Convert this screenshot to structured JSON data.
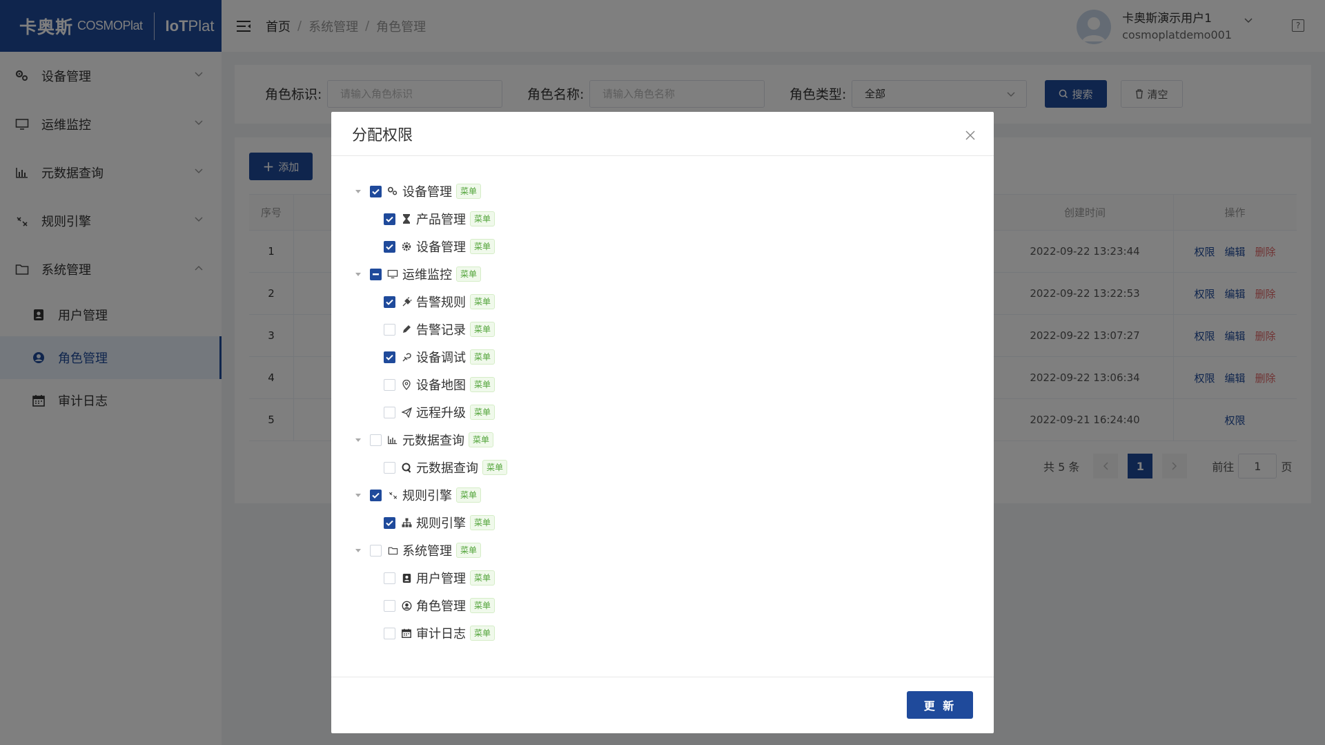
{
  "brand": {
    "cn": "卡奥斯",
    "cosmo": "COSMOPlat",
    "iot_prefix": "IoT",
    "iot_suffix": "Plat"
  },
  "sidebar": {
    "items": [
      {
        "label": "设备管理",
        "icon": "gears-icon"
      },
      {
        "label": "运维监控",
        "icon": "monitor-icon"
      },
      {
        "label": "元数据查询",
        "icon": "bar-chart-icon"
      },
      {
        "label": "规则引擎",
        "icon": "link-icon"
      },
      {
        "label": "系统管理",
        "icon": "folder-icon"
      }
    ],
    "sub_items": [
      {
        "label": "用户管理",
        "icon": "contact-book-icon"
      },
      {
        "label": "角色管理",
        "icon": "user-circle-icon"
      },
      {
        "label": "审计日志",
        "icon": "calendar-icon"
      }
    ]
  },
  "header": {
    "breadcrumb": [
      "首页",
      "系统管理",
      "角色管理"
    ],
    "separator": "/",
    "user_name": "卡奥斯演示用户1",
    "user_account": "cosmoplatdemo001",
    "help": "?"
  },
  "filter": {
    "role_id_label": "角色标识:",
    "role_id_placeholder": "请输入角色标识",
    "role_name_label": "角色名称:",
    "role_name_placeholder": "请输入角色名称",
    "role_type_label": "角色类型:",
    "role_type_value": "全部",
    "search_label": "搜索",
    "clear_label": "清空"
  },
  "table": {
    "add_label": "添加",
    "columns": {
      "index": "序号",
      "created": "创建时间",
      "actions": "操作"
    },
    "rows": [
      {
        "index": "1",
        "created": "2022-09-22 13:23:44",
        "perm": "权限",
        "edit": "编辑",
        "del": "删除"
      },
      {
        "index": "2",
        "created": "2022-09-22 13:22:53",
        "perm": "权限",
        "edit": "编辑",
        "del": "删除"
      },
      {
        "index": "3",
        "created": "2022-09-22 13:07:27",
        "perm": "权限",
        "edit": "编辑",
        "del": "删除"
      },
      {
        "index": "4",
        "created": "2022-09-22 13:06:34",
        "perm": "权限",
        "edit": "编辑",
        "del": "删除"
      },
      {
        "index": "5",
        "created": "2022-09-21 16:24:40",
        "perm": "权限"
      }
    ],
    "pagination": {
      "total": "共 5 条",
      "current": "1",
      "goto_label": "前往",
      "goto_value": "1",
      "page_suffix": "页"
    }
  },
  "dialog": {
    "title": "分配权限",
    "update_label": "更 新",
    "tag": "菜单",
    "nodes": [
      {
        "label": "设备管理",
        "level": 0,
        "state": "checked",
        "icon": "gears-icon"
      },
      {
        "label": "产品管理",
        "level": 1,
        "state": "checked",
        "icon": "hourglass-icon"
      },
      {
        "label": "设备管理",
        "level": 1,
        "state": "checked",
        "icon": "gear-icon"
      },
      {
        "label": "运维监控",
        "level": 0,
        "state": "indeterminate",
        "icon": "monitor-icon"
      },
      {
        "label": "告警规则",
        "level": 1,
        "state": "checked",
        "icon": "plug-icon"
      },
      {
        "label": "告警记录",
        "level": 1,
        "state": "unchecked",
        "icon": "pencil-icon"
      },
      {
        "label": "设备调试",
        "level": 1,
        "state": "checked",
        "icon": "debug-icon"
      },
      {
        "label": "设备地图",
        "level": 1,
        "state": "unchecked",
        "icon": "map-pin-icon"
      },
      {
        "label": "远程升级",
        "level": 1,
        "state": "unchecked",
        "icon": "send-icon"
      },
      {
        "label": "元数据查询",
        "level": 0,
        "state": "unchecked",
        "icon": "bar-chart-icon"
      },
      {
        "label": "元数据查询",
        "level": 1,
        "state": "unchecked",
        "icon": "search-q-icon"
      },
      {
        "label": "规则引擎",
        "level": 0,
        "state": "checked",
        "icon": "link-icon"
      },
      {
        "label": "规则引擎",
        "level": 1,
        "state": "checked",
        "icon": "sitemap-icon"
      },
      {
        "label": "系统管理",
        "level": 0,
        "state": "unchecked",
        "icon": "folder-icon"
      },
      {
        "label": "用户管理",
        "level": 1,
        "state": "unchecked",
        "icon": "contact-book-icon"
      },
      {
        "label": "角色管理",
        "level": 1,
        "state": "unchecked",
        "icon": "user-circle-icon"
      },
      {
        "label": "审计日志",
        "level": 1,
        "state": "unchecked",
        "icon": "calendar-icon"
      }
    ]
  },
  "colors": {
    "brand": "#1f4a9b",
    "danger": "#e06666",
    "tag_green": "#52a43a"
  }
}
